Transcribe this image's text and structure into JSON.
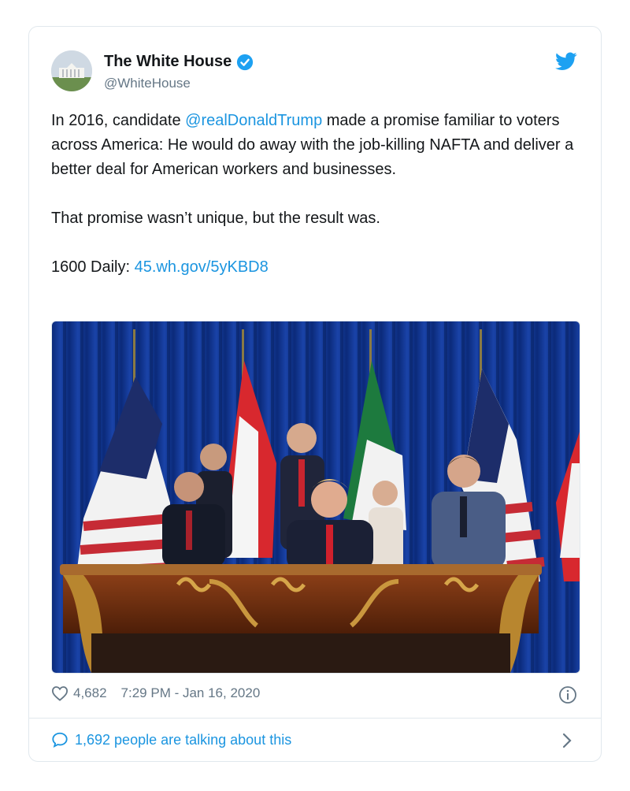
{
  "author": {
    "display_name": "The White House",
    "handle": "@WhiteHouse"
  },
  "tweet": {
    "text_part1": "In 2016, candidate ",
    "mention": "@realDonaldTrump",
    "text_part2": " made a promise familiar to voters across America: He would do away with the job-killing NAFTA and deliver a better deal for American workers and businesses.",
    "paragraph2": "That promise wasn’t unique, but the result was.",
    "paragraph3_prefix": "1600 Daily: ",
    "link": "45.wh.gov/5yKBD8"
  },
  "footer": {
    "likes": "4,682",
    "timestamp": "7:29 PM - Jan 16, 2020",
    "talking": "1,692 people are talking about this"
  },
  "colors": {
    "link": "#1b95e0",
    "muted": "#657786",
    "border": "#e1e8ed"
  },
  "icons": [
    "verified-badge-icon",
    "twitter-bird-icon",
    "heart-icon",
    "info-icon",
    "speech-bubble-icon",
    "chevron-right-icon"
  ]
}
